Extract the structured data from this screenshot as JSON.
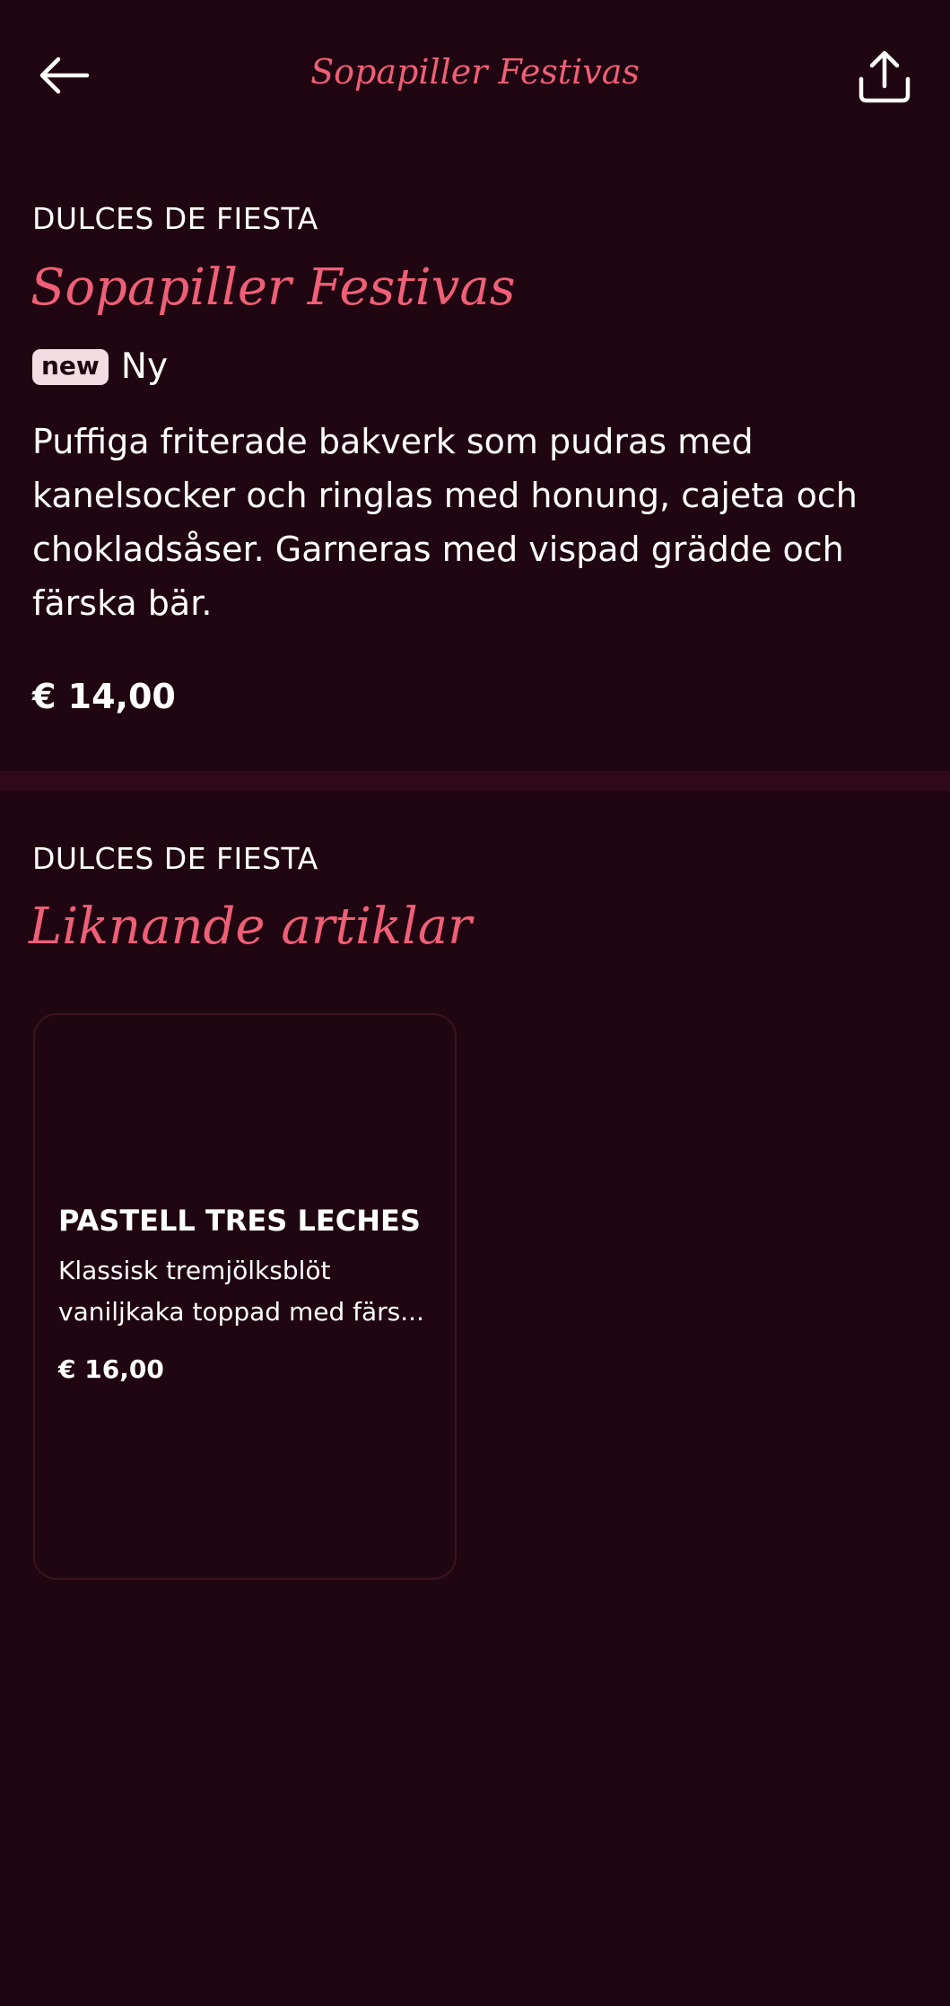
{
  "header": {
    "title": "Sopapiller Festivas",
    "back_icon": "arrow-left-icon",
    "share_icon": "share-icon"
  },
  "product": {
    "category": "DULCES DE FIESTA",
    "name": "Sopapiller Festivas",
    "badge": "new",
    "badge_label": "Ny",
    "description": "Puffiga friterade bakverk som pudras med kanelsocker och ringlas med honung, cajeta och chokladsåser. Garneras med vispad grädde och färska bär.",
    "price": "€ 14,00"
  },
  "similar": {
    "category": "DULCES DE FIESTA",
    "heading": "Liknande artiklar",
    "items": [
      {
        "name": "PASTELL TRES LECHES",
        "description_line1": "Klassisk tremjölksblöt",
        "description_line2": "vaniljkaka toppad med färs...",
        "price": "€ 16,00"
      }
    ]
  },
  "colors": {
    "background": "#200610",
    "accent": "#ef5f77",
    "divider": "#300a18",
    "badge_bg": "#f4dde2"
  }
}
